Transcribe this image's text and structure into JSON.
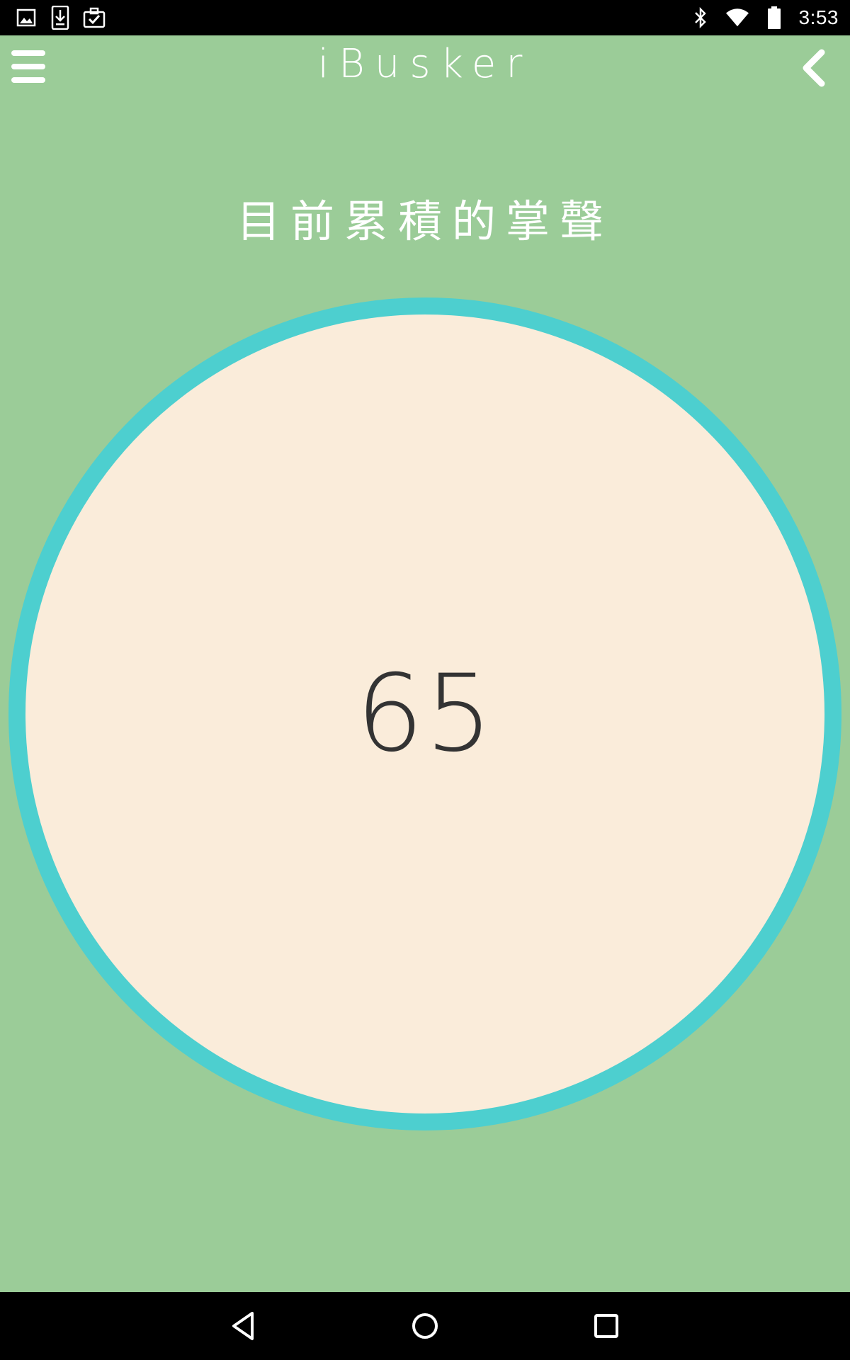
{
  "status_bar": {
    "time": "3:53",
    "left_icons": [
      "image-icon",
      "download-icon",
      "clipboard-check-icon"
    ],
    "right_icons": [
      "bluetooth-icon",
      "wifi-icon",
      "battery-icon"
    ]
  },
  "app_bar": {
    "title": "iBusker",
    "menu_icon": "hamburger-menu-icon",
    "back_icon": "chevron-left-icon"
  },
  "main": {
    "heading": "目前累積的掌聲",
    "applause_count": "65"
  },
  "nav_bar": {
    "buttons": [
      "back-triangle-icon",
      "home-circle-icon",
      "recents-square-icon"
    ]
  },
  "colors": {
    "background": "#9bcc98",
    "ring": "#4dcfcf",
    "circle_fill": "#faecda",
    "count_text": "#333333",
    "bars": "#000000"
  }
}
